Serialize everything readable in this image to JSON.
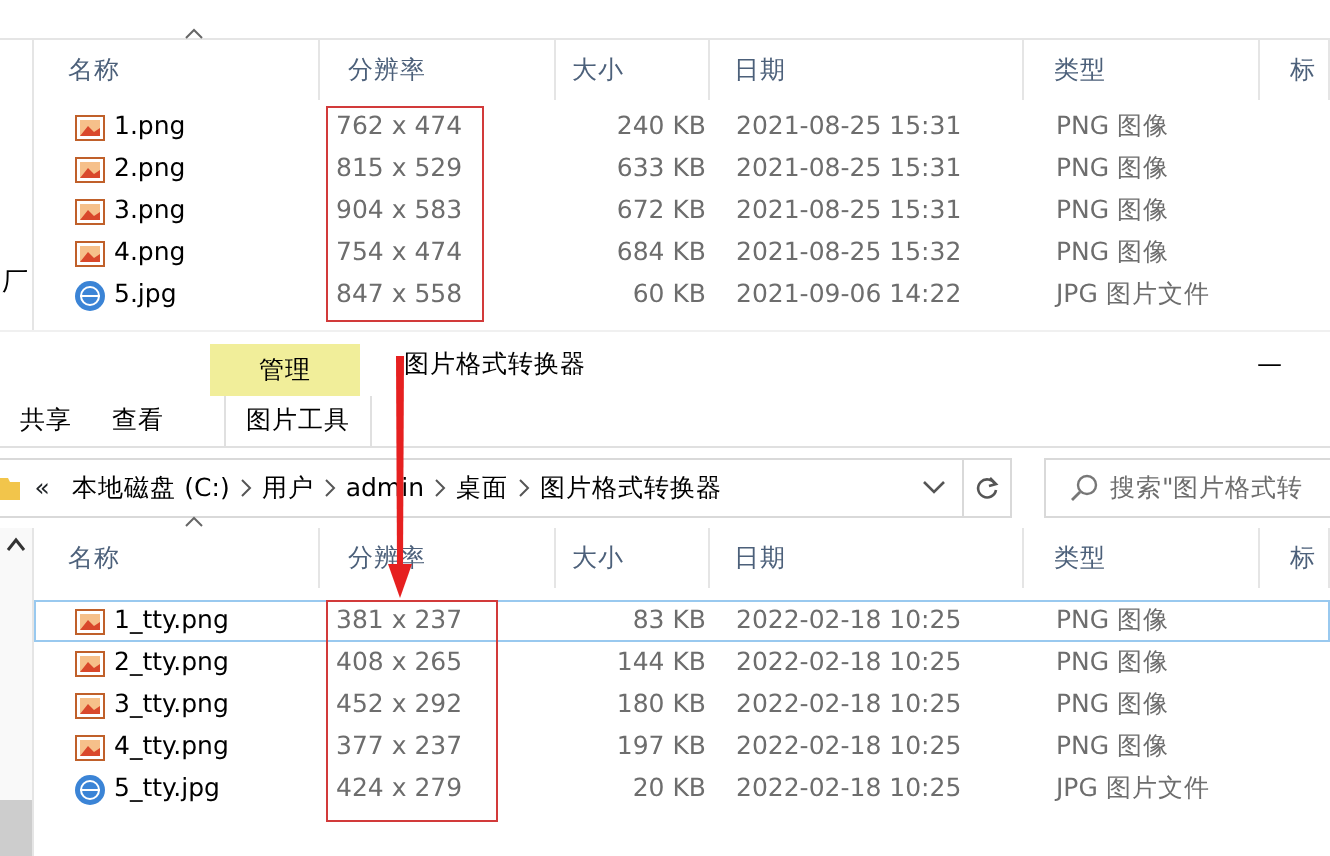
{
  "top_window": {
    "sidebar_fragment": "厂",
    "columns": [
      "名称",
      "分辨率",
      "大小",
      "日期",
      "类型",
      "标"
    ],
    "resolution_framed": true,
    "rows": [
      {
        "kind": "png",
        "name": "1.png",
        "resolution": "762 x 474",
        "size": "240 KB",
        "date": "2021-08-25 15:31",
        "type": "PNG 图像"
      },
      {
        "kind": "png",
        "name": "2.png",
        "resolution": "815 x 529",
        "size": "633 KB",
        "date": "2021-08-25 15:31",
        "type": "PNG 图像"
      },
      {
        "kind": "png",
        "name": "3.png",
        "resolution": "904 x 583",
        "size": "672 KB",
        "date": "2021-08-25 15:31",
        "type": "PNG 图像"
      },
      {
        "kind": "png",
        "name": "4.png",
        "resolution": "754 x 474",
        "size": "684 KB",
        "date": "2021-08-25 15:32",
        "type": "PNG 图像"
      },
      {
        "kind": "jpg",
        "name": "5.jpg",
        "resolution": "847 x 558",
        "size": "60 KB",
        "date": "2021-09-06 14:22",
        "type": "JPG 图片文件"
      }
    ]
  },
  "bottom_window": {
    "context_tab": "管理",
    "title": "图片格式转换器",
    "minimize": "—",
    "ribbon_tabs": [
      {
        "label": "共享",
        "kind": "tab"
      },
      {
        "label": "查看",
        "kind": "tab"
      },
      {
        "label": "图片工具",
        "kind": "context"
      }
    ],
    "nav_back": "«",
    "breadcrumb": [
      "本地磁盘 (C:)",
      "用户",
      "admin",
      "桌面",
      "图片格式转换器"
    ],
    "search": {
      "placeholder": "搜索\"图片格式转"
    },
    "columns": [
      "名称",
      "分辨率",
      "大小",
      "日期",
      "类型",
      "标"
    ],
    "resolution_framed": true,
    "rows": [
      {
        "kind": "png",
        "name": "1_tty.png",
        "resolution": "381 x 237",
        "size": "83 KB",
        "date": "2022-02-18 10:25",
        "type": "PNG 图像",
        "selected": true
      },
      {
        "kind": "png",
        "name": "2_tty.png",
        "resolution": "408 x 265",
        "size": "144 KB",
        "date": "2022-02-18 10:25",
        "type": "PNG 图像",
        "selected": false
      },
      {
        "kind": "png",
        "name": "3_tty.png",
        "resolution": "452 x 292",
        "size": "180 KB",
        "date": "2022-02-18 10:25",
        "type": "PNG 图像",
        "selected": false
      },
      {
        "kind": "png",
        "name": "4_tty.png",
        "resolution": "377 x 237",
        "size": "197 KB",
        "date": "2022-02-18 10:25",
        "type": "PNG 图像",
        "selected": false
      },
      {
        "kind": "jpg",
        "name": "5_tty.jpg",
        "resolution": "424 x 279",
        "size": "20 KB",
        "date": "2022-02-18 10:25",
        "type": "JPG 图片文件",
        "selected": false
      }
    ]
  },
  "annotation_arrow": true
}
